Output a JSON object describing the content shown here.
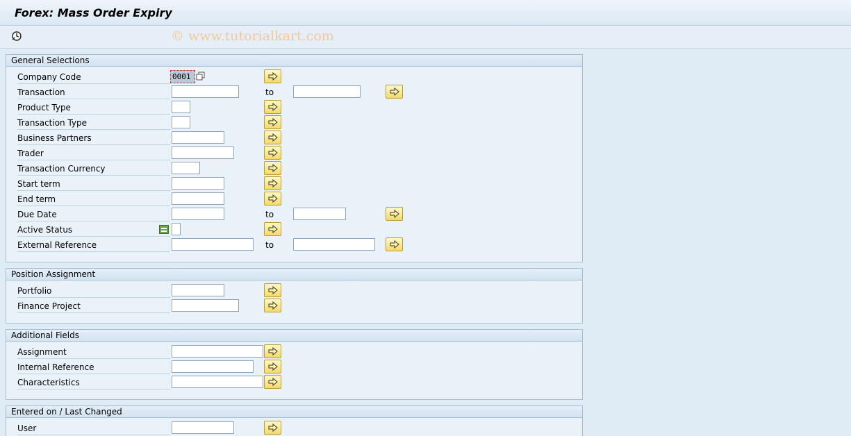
{
  "window": {
    "title": "Forex: Mass Order Expiry"
  },
  "toolbar": {
    "execute_icon": "execute-clock-icon"
  },
  "watermark": "© www.tutorialkart.com",
  "groups": {
    "general": {
      "title": "General Selections",
      "company_code": {
        "label": "Company Code",
        "value": "0001"
      },
      "transaction": {
        "label": "Transaction",
        "to": "to"
      },
      "product_type": {
        "label": "Product Type"
      },
      "transaction_type": {
        "label": "Transaction Type"
      },
      "business_partners": {
        "label": "Business Partners"
      },
      "trader": {
        "label": "Trader"
      },
      "transaction_currency": {
        "label": "Transaction Currency"
      },
      "start_term": {
        "label": "Start term"
      },
      "end_term": {
        "label": "End term"
      },
      "due_date": {
        "label": "Due Date",
        "to": "to"
      },
      "active_status": {
        "label": "Active Status"
      },
      "external_reference": {
        "label": "External Reference",
        "to": "to"
      }
    },
    "position": {
      "title": "Position Assignment",
      "portfolio": {
        "label": "Portfolio"
      },
      "finance_project": {
        "label": "Finance Project"
      }
    },
    "additional": {
      "title": "Additional Fields",
      "assignment": {
        "label": "Assignment"
      },
      "internal_reference": {
        "label": "Internal Reference"
      },
      "characteristics": {
        "label": "Characteristics"
      }
    },
    "entered": {
      "title": "Entered on / Last Changed",
      "user": {
        "label": "User"
      }
    }
  },
  "colors": {
    "background": "#dfebf5",
    "arrow_button": "#f4d96a",
    "status_icon": "#6ba24a"
  }
}
